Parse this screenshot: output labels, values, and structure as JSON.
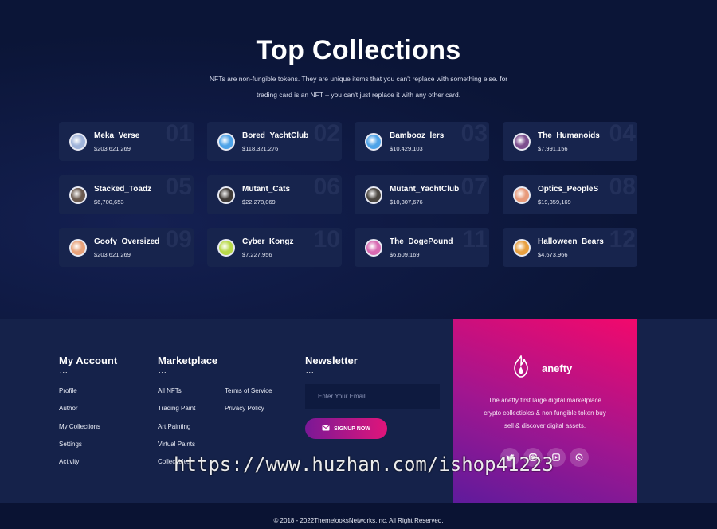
{
  "header": {
    "title": "Top Collections",
    "subtitle_line1": "NFTs are non-fungible tokens. They are unique items that you can't replace with something else. for",
    "subtitle_line2": "trading card is an NFT – you can't just replace it with any other card."
  },
  "collections": [
    {
      "num": "01",
      "name": "Meka_Verse",
      "value": "$203,621,269",
      "color": "#9fb3d9"
    },
    {
      "num": "02",
      "name": "Bored_YachtClub",
      "value": "$118,321,276",
      "color": "#4ea3e8"
    },
    {
      "num": "03",
      "name": "Bambooz_lers",
      "value": "$10,429,103",
      "color": "#4ea3e8"
    },
    {
      "num": "04",
      "name": "The_Humanoids",
      "value": "$7,991,156",
      "color": "#7d4f8f"
    },
    {
      "num": "05",
      "name": "Stacked_Toadz",
      "value": "$6,700,653",
      "color": "#6b5a4f"
    },
    {
      "num": "06",
      "name": "Mutant_Cats",
      "value": "$22,278,069",
      "color": "#3f3a36"
    },
    {
      "num": "07",
      "name": "Mutant_YachtClub",
      "value": "$10,307,676",
      "color": "#4a4640"
    },
    {
      "num": "08",
      "name": "Optics_PeopleS",
      "value": "$19,359,169",
      "color": "#e89a7a"
    },
    {
      "num": "09",
      "name": "Goofy_Oversized",
      "value": "$203,621,269",
      "color": "#e8a27a"
    },
    {
      "num": "10",
      "name": "Cyber_Kongz",
      "value": "$7,227,956",
      "color": "#b9d94a"
    },
    {
      "num": "11",
      "name": "The_DogePound",
      "value": "$6,609,169",
      "color": "#d86ab2"
    },
    {
      "num": "12",
      "name": "Halloween_Bears",
      "value": "$4,673,966",
      "color": "#e8a040"
    }
  ],
  "footer": {
    "account": {
      "title": "My Account",
      "dots": "...",
      "links": [
        "Profile",
        "Author",
        "My Collections",
        "Settings",
        "Activity"
      ]
    },
    "marketplace": {
      "title": "Marketplace",
      "dots": "...",
      "links_col1": [
        "All NFTs",
        "Trading Paint",
        "Art Painting",
        "Virtual Paints",
        "Collectibles"
      ],
      "links_col2": [
        "Terms of Service",
        "Privacy Policy"
      ]
    },
    "newsletter": {
      "title": "Newsletter",
      "dots": "...",
      "placeholder": "Enter Your Email...",
      "button": "SIGNUP NOW"
    },
    "brand": {
      "name": "anefty",
      "description_line1": "The anefty first large digital marketplace",
      "description_line2": "crypto collectibles & non fungible token buy",
      "description_line3": "sell & discover digital assets.",
      "socials": [
        "twitter-icon",
        "instagram-icon",
        "youtube-icon",
        "whatsapp-icon"
      ]
    },
    "copyright": "© 2018 - 2022ThemelooksNetworks,Inc. All Right Reserved."
  },
  "watermark": "https://www.huzhan.com/ishop41223"
}
